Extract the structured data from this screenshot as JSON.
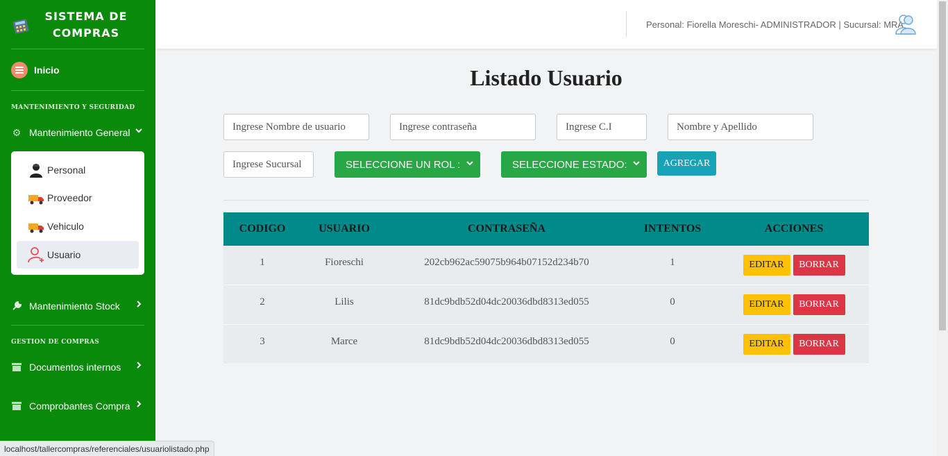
{
  "brand": {
    "title_line1": "SISTEMA DE",
    "title_line2": "COMPRAS"
  },
  "sidebar": {
    "inicio": "Inicio",
    "section1": "MANTENIMIENTO Y SEGURIDAD",
    "mant_general": "Mantenimiento General",
    "sub_items": [
      "Personal",
      "Proveedor",
      "Vehiculo",
      "Usuario"
    ],
    "active_sub": "Usuario",
    "mant_stock": "Mantenimiento Stock",
    "section2": "GESTION DE COMPRAS",
    "doc_internos": "Documentos internos",
    "comprobantes": "Comprobantes Compra"
  },
  "topbar": {
    "user_info": "Personal: Fiorella Moreschi- ADMINISTRADOR | Sucursal: MRA"
  },
  "main": {
    "title": "Listado Usuario",
    "form": {
      "username_ph": "Ingrese Nombre de usuario",
      "password_ph": "Ingrese contraseña",
      "ci_ph": "Ingrese C.I",
      "nombre_ph": "Nombre y Apellido",
      "sucursal_ph": "Ingrese Sucursal",
      "rol_select": "SELECCIONE UN ROL :",
      "estado_select": "SELECCIONE ESTADO:",
      "add_button": "AGREGAR"
    },
    "table": {
      "headers": [
        "CODIGO",
        "USUARIO",
        "CONTRASEÑA",
        "INTENTOS",
        "ACCIONES"
      ],
      "rows": [
        {
          "codigo": "1",
          "usuario": "Fioreschi",
          "contrasena": "202cb962ac59075b964b07152d234b70",
          "intentos": "1"
        },
        {
          "codigo": "2",
          "usuario": "Lilis",
          "contrasena": "81dc9bdb52d04dc20036dbd8313ed055",
          "intentos": "0"
        },
        {
          "codigo": "3",
          "usuario": "Marce",
          "contrasena": "81dc9bdb52d04dc20036dbd8313ed055",
          "intentos": "0"
        }
      ],
      "edit_label": "EDITAR",
      "delete_label": "BORRAR"
    }
  },
  "statusbar": {
    "url": "localhost/tallercompras/referenciales/usuariolistado.php"
  },
  "colors": {
    "sidebar": "#0a8a0a",
    "table_header": "#008b8b",
    "select_green": "#28a745",
    "add_blue": "#17a2b8",
    "edit_yellow": "#ffc107",
    "delete_red": "#dc3545"
  },
  "icons": [
    "calculator-logo-icon",
    "home-menu-icon",
    "gear-icon",
    "chevron-down-icon",
    "person-icon",
    "truck-icon",
    "user-add-icon",
    "wrench-icon",
    "chevron-right-icon",
    "archive-icon",
    "users-avatar-icon"
  ]
}
